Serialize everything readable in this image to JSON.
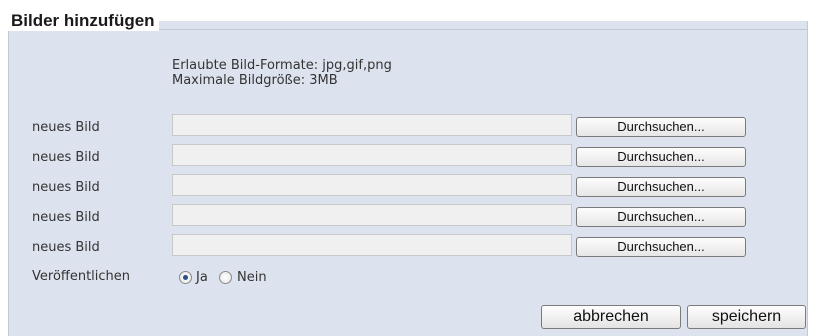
{
  "section": {
    "legend": "Bilder hinzufügen",
    "info_formats": "Erlaubte Bild-Formate: jpg,gif,png",
    "info_size": "Maximale Bildgröße: 3MB"
  },
  "uploads": [
    {
      "label": "neues Bild",
      "value": "",
      "button": "Durchsuchen..."
    },
    {
      "label": "neues Bild",
      "value": "",
      "button": "Durchsuchen..."
    },
    {
      "label": "neues Bild",
      "value": "",
      "button": "Durchsuchen..."
    },
    {
      "label": "neues Bild",
      "value": "",
      "button": "Durchsuchen..."
    },
    {
      "label": "neues Bild",
      "value": "",
      "button": "Durchsuchen..."
    }
  ],
  "publish": {
    "label": "Veröffentlichen",
    "options": [
      "Ja",
      "Nein"
    ],
    "selected": "Ja"
  },
  "actions": {
    "cancel": "abbrechen",
    "save": "speichern"
  }
}
